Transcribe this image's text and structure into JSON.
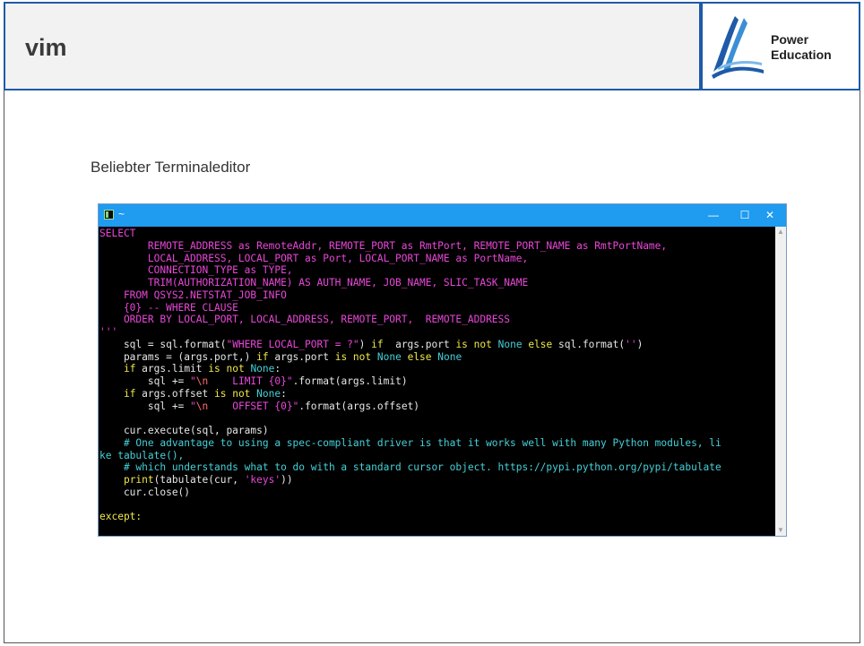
{
  "slide": {
    "title": "vim",
    "subtitle": "Beliebter Terminaleditor",
    "logo": {
      "line1": "Power",
      "line2": "Education"
    }
  },
  "terminal": {
    "window_title": "~",
    "controls": {
      "minimize": "—",
      "maximize": "☐",
      "close": "✕"
    },
    "lines": [
      [
        {
          "t": "SELECT",
          "c": "mag"
        }
      ],
      [
        {
          "t": "        REMOTE_ADDRESS as RemoteAddr, REMOTE_PORT as RmtPort, REMOTE_PORT_NAME as RmtPortName,",
          "c": "mag"
        }
      ],
      [
        {
          "t": "        LOCAL_ADDRESS, LOCAL_PORT as Port, LOCAL_PORT_NAME as PortName,",
          "c": "mag"
        }
      ],
      [
        {
          "t": "        CONNECTION_TYPE as TYPE,",
          "c": "mag"
        }
      ],
      [
        {
          "t": "        TRIM(AUTHORIZATION_NAME) AS AUTH_NAME, JOB_NAME, SLIC_TASK_NAME",
          "c": "mag"
        }
      ],
      [
        {
          "t": "    FROM QSYS2.NETSTAT_JOB_INFO",
          "c": "mag"
        }
      ],
      [
        {
          "t": "    {0} -- WHERE CLAUSE",
          "c": "mag"
        }
      ],
      [
        {
          "t": "    ORDER BY LOCAL_PORT, LOCAL_ADDRESS, REMOTE_PORT,  REMOTE_ADDRESS",
          "c": "mag"
        }
      ],
      [
        {
          "t": "'''",
          "c": "mag"
        }
      ],
      [
        {
          "t": "    sql = sql.format(",
          "c": "wht"
        },
        {
          "t": "\"WHERE LOCAL_PORT = ?\"",
          "c": "mag"
        },
        {
          "t": ") ",
          "c": "wht"
        },
        {
          "t": "if",
          "c": "yel"
        },
        {
          "t": "  args.port ",
          "c": "wht"
        },
        {
          "t": "is not",
          "c": "yel"
        },
        {
          "t": " ",
          "c": "wht"
        },
        {
          "t": "None",
          "c": "cyn"
        },
        {
          "t": " ",
          "c": "wht"
        },
        {
          "t": "else",
          "c": "yel"
        },
        {
          "t": " sql.format(",
          "c": "wht"
        },
        {
          "t": "''",
          "c": "mag"
        },
        {
          "t": ")",
          "c": "wht"
        }
      ],
      [
        {
          "t": "    params = (args.port,) ",
          "c": "wht"
        },
        {
          "t": "if",
          "c": "yel"
        },
        {
          "t": " args.port ",
          "c": "wht"
        },
        {
          "t": "is not",
          "c": "yel"
        },
        {
          "t": " ",
          "c": "wht"
        },
        {
          "t": "None",
          "c": "cyn"
        },
        {
          "t": " ",
          "c": "wht"
        },
        {
          "t": "else",
          "c": "yel"
        },
        {
          "t": " ",
          "c": "wht"
        },
        {
          "t": "None",
          "c": "cyn"
        }
      ],
      [
        {
          "t": "    ",
          "c": "wht"
        },
        {
          "t": "if",
          "c": "yel"
        },
        {
          "t": " args.limit ",
          "c": "wht"
        },
        {
          "t": "is not",
          "c": "yel"
        },
        {
          "t": " ",
          "c": "wht"
        },
        {
          "t": "None",
          "c": "cyn"
        },
        {
          "t": ":",
          "c": "wht"
        }
      ],
      [
        {
          "t": "        sql += ",
          "c": "wht"
        },
        {
          "t": "\"",
          "c": "mag"
        },
        {
          "t": "\\n",
          "c": "red"
        },
        {
          "t": "    LIMIT {0}\"",
          "c": "mag"
        },
        {
          "t": ".format(args.limit)",
          "c": "wht"
        }
      ],
      [
        {
          "t": "    ",
          "c": "wht"
        },
        {
          "t": "if",
          "c": "yel"
        },
        {
          "t": " args.offset ",
          "c": "wht"
        },
        {
          "t": "is not",
          "c": "yel"
        },
        {
          "t": " ",
          "c": "wht"
        },
        {
          "t": "None",
          "c": "cyn"
        },
        {
          "t": ":",
          "c": "wht"
        }
      ],
      [
        {
          "t": "        sql += ",
          "c": "wht"
        },
        {
          "t": "\"",
          "c": "mag"
        },
        {
          "t": "\\n",
          "c": "red"
        },
        {
          "t": "    OFFSET {0}\"",
          "c": "mag"
        },
        {
          "t": ".format(args.offset)",
          "c": "wht"
        }
      ],
      [
        {
          "t": "",
          "c": "wht"
        }
      ],
      [
        {
          "t": "    cur.execute(sql, params)",
          "c": "wht"
        }
      ],
      [
        {
          "t": "    # One advantage to using a spec-compliant driver is that it works well with many Python modules, li",
          "c": "cyn"
        }
      ],
      [
        {
          "t": "ke tabulate(),",
          "c": "cyn"
        }
      ],
      [
        {
          "t": "    # which understands what to do with a standard cursor object. https://pypi.python.org/pypi/tabulate",
          "c": "cyn"
        }
      ],
      [
        {
          "t": "    ",
          "c": "wht"
        },
        {
          "t": "print",
          "c": "yel"
        },
        {
          "t": "(tabulate(cur, ",
          "c": "wht"
        },
        {
          "t": "'keys'",
          "c": "mag"
        },
        {
          "t": "))",
          "c": "wht"
        }
      ],
      [
        {
          "t": "    cur.close()",
          "c": "wht"
        }
      ],
      [
        {
          "t": "",
          "c": "wht"
        }
      ],
      [
        {
          "t": "except:",
          "c": "yel"
        }
      ]
    ]
  }
}
